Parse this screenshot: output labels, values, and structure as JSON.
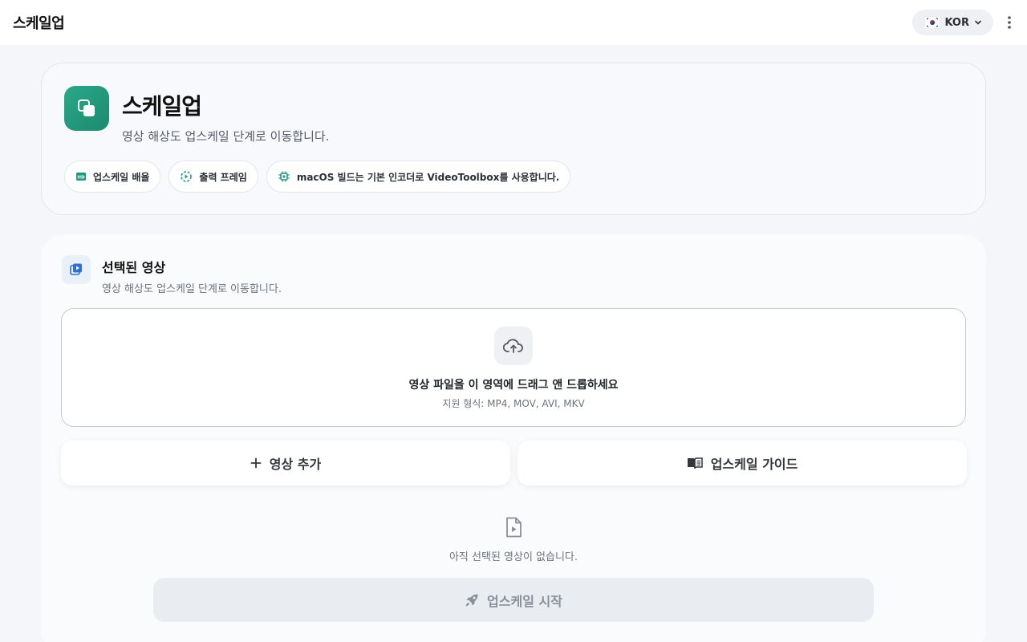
{
  "appbar": {
    "title": "스케일업",
    "language": "KOR"
  },
  "hero": {
    "title": "스케일업",
    "subtitle": "영상 해상도 업스케일 단계로 이동합니다.",
    "chips": [
      {
        "label": "업스케일 배율",
        "icon": "hd-icon"
      },
      {
        "label": "출력 프레임",
        "icon": "frame-rate-icon"
      },
      {
        "label": "macOS 빌드는 기본 인코더로 VideoToolbox를 사용합니다.",
        "icon": "chip-icon"
      }
    ]
  },
  "panel": {
    "title": "선택된 영상",
    "subtitle": "영상 해상도 업스케일 단계로 이동합니다.",
    "dropzone": {
      "main": "영상 파일을 이 영역에 드래그 앤 드롭하세요",
      "sub": "지원 형식: MP4, MOV, AVI, MKV"
    },
    "add_label": "영상 추가",
    "guide_label": "업스케일 가이드",
    "empty_text": "아직 선택된 영상이 없습니다."
  },
  "start_label": "업스케일 시작",
  "colors": {
    "accent": "#1f9a7c",
    "background": "#f4f6f9",
    "disabled_button": "#e9ecf0"
  }
}
